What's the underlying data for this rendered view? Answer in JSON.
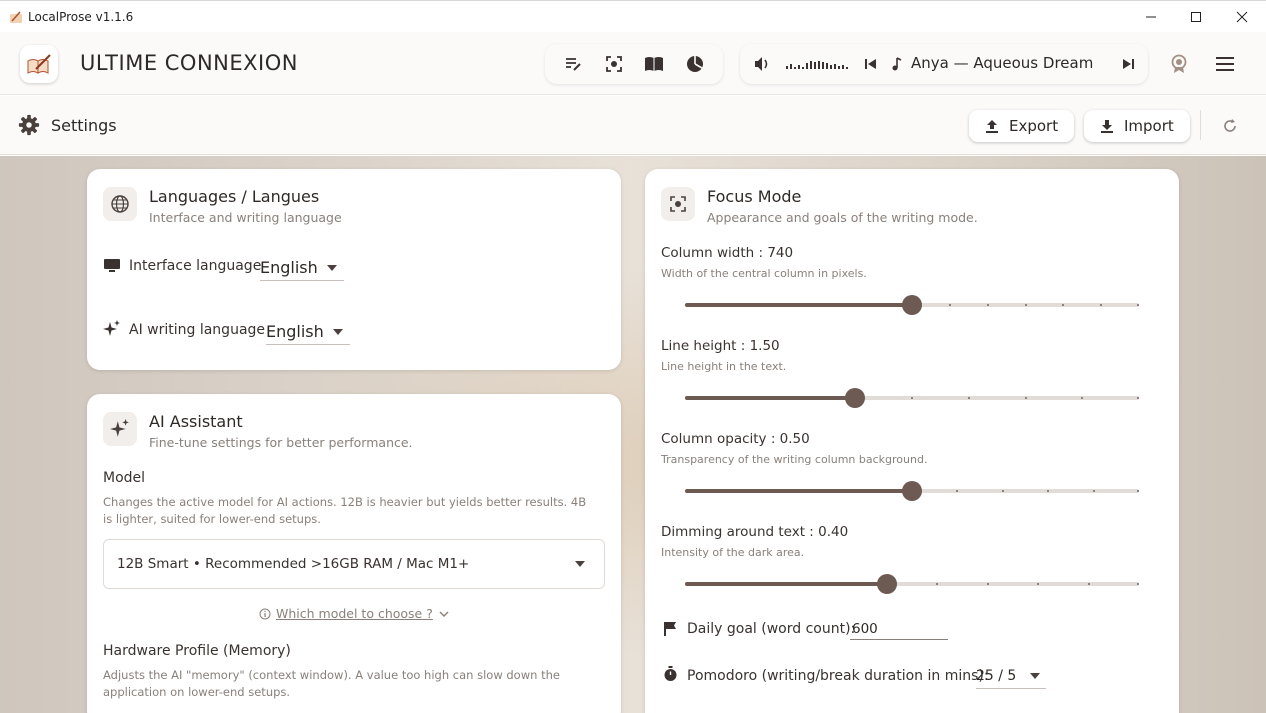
{
  "window": {
    "title": "LocalProse v1.1.6"
  },
  "header": {
    "brand": "ULTIME CONNEXION",
    "player": {
      "track": "Anya — Aqueous Dream",
      "waveform": ".,.,.,,,,,,.,."
    }
  },
  "settings": {
    "title": "Settings",
    "export_label": "Export",
    "import_label": "Import"
  },
  "languages": {
    "title": "Languages / Langues",
    "subtitle": "Interface and writing language",
    "interface_label": "Interface language",
    "interface_value": "English",
    "ai_label": "AI writing language",
    "ai_value": "English"
  },
  "assistant": {
    "title": "AI Assistant",
    "subtitle": "Fine-tune settings for better performance.",
    "model_label": "Model",
    "model_desc": "Changes the active model for AI actions. 12B is heavier but yields better results. 4B is lighter, suited for lower-end setups.",
    "model_value": "12B Smart • Recommended >16GB RAM / Mac M1+",
    "which_model": "Which model to choose ?",
    "hardware_label": "Hardware Profile (Memory)",
    "hardware_desc": "Adjusts the AI \"memory\" (context window). A value too high can slow down the application on lower-end setups."
  },
  "focus": {
    "title": "Focus Mode",
    "subtitle": "Appearance and goals of the writing mode.",
    "sliders": [
      {
        "label": "Column width : 740",
        "desc": "Width of the central column in pixels.",
        "value_fraction": 0.5
      },
      {
        "label": "Line height : 1.50",
        "desc": "Line height in the text.",
        "value_fraction": 0.375
      },
      {
        "label": "Column opacity : 0.50",
        "desc": "Transparency of the writing column background.",
        "value_fraction": 0.5
      },
      {
        "label": "Dimming around text : 0.40",
        "desc": "Intensity of the dark area.",
        "value_fraction": 0.444
      }
    ],
    "daily_goal_label": "Daily goal (word count):",
    "daily_goal_value": "600",
    "pomodoro_label": "Pomodoro (writing/break duration in mins):",
    "pomodoro_value": "25 / 5"
  },
  "colors": {
    "accent": "#6d5a52",
    "track": "#e2dcd8",
    "text": "#2e2926",
    "muted": "#8a807b"
  }
}
